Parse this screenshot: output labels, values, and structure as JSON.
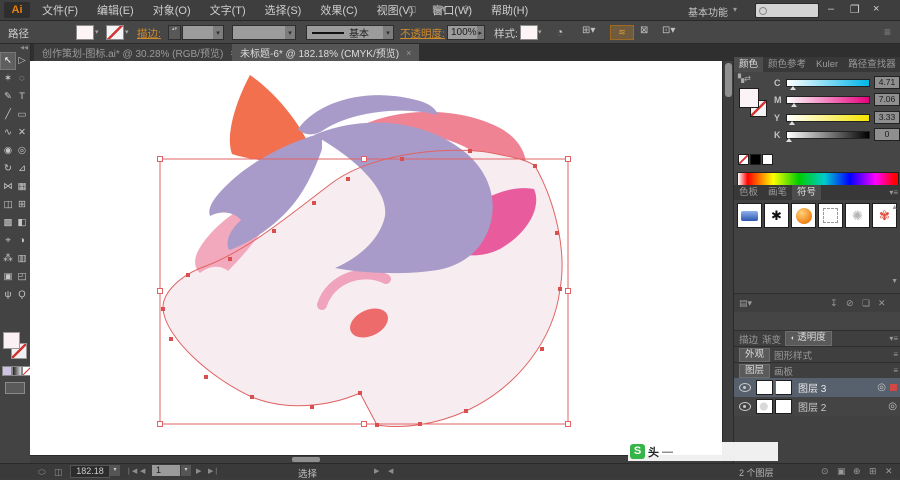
{
  "titlebar": {
    "logo": "Ai",
    "menus": [
      "文件(F)",
      "编辑(E)",
      "对象(O)",
      "文字(T)",
      "选择(S)",
      "效果(C)",
      "视图(V)",
      "窗口(W)",
      "帮助(H)"
    ],
    "workspace": "基本功能",
    "search_placeholder": "",
    "min": "–",
    "restore": "❐",
    "close": "×"
  },
  "options": {
    "target": "路径",
    "stroke_label": "描边:",
    "stroke_style": "基本",
    "opacity_label": "不透明度:",
    "opacity": "100%",
    "style_label": "样式:"
  },
  "doc_tabs": [
    {
      "title": "创作策划-图标.ai* @ 30.28% (RGB/预览)"
    },
    {
      "title": "未标题-6* @ 182.18% (CMYK/预览)"
    }
  ],
  "ui": {
    "close": "×",
    "caret": "▾",
    "menu": "≡",
    "collapse": "◀◀",
    "updown": "▴▾"
  },
  "tools": [
    [
      "↖",
      "▷"
    ],
    [
      "✶",
      "◌"
    ],
    [
      "✎",
      "T"
    ],
    [
      "╱",
      "▭"
    ],
    [
      "∿",
      "✕"
    ],
    [
      "◉",
      "◎"
    ],
    [
      "↻",
      "⊿"
    ],
    [
      "⋈",
      "▦"
    ],
    [
      "◫",
      "⊞"
    ],
    [
      "▩",
      "◧"
    ],
    [
      "⌖",
      "◑"
    ],
    [
      "⁂",
      "▥"
    ],
    [
      "▣",
      "◰"
    ],
    [
      "ψ",
      "Ϙ"
    ]
  ],
  "color_panel": {
    "tabs": [
      "颜色",
      "颜色参考",
      "Kuler",
      "路径查找器"
    ],
    "channels": [
      {
        "label": "C",
        "value": "4.71"
      },
      {
        "label": "M",
        "value": "7.06"
      },
      {
        "label": "Y",
        "value": "3.33"
      },
      {
        "label": "K",
        "value": "0"
      }
    ],
    "unit": "%"
  },
  "swatch_panel": {
    "tabs": [
      "色板",
      "画笔",
      "符号"
    ],
    "symbols": [
      "banner-blue",
      "splatter-black",
      "orb-orange",
      "frame-dashed",
      "ring-silver",
      "flower-red"
    ]
  },
  "groups": {
    "stroke": "描边",
    "gradient": "渐变",
    "transparency": "透明度",
    "appearance": "外观",
    "graphic_styles": "图形样式",
    "layers": "图层",
    "artboards": "画板"
  },
  "layers_panel": {
    "items": [
      {
        "name": "图层 3"
      },
      {
        "name": "图层 2"
      }
    ],
    "count": "2 个图层"
  },
  "status": {
    "zoom": "182.18",
    "artboard": "1",
    "mode": "选择"
  },
  "watermark": {
    "badge": "S",
    "text": "头",
    "dash": "—"
  },
  "artwork": {
    "subject": "unicorn-head-illustration",
    "palette": {
      "horn": "#f2704e",
      "mane_purple": "#a89bc9",
      "mane_salmon": "#ef8394",
      "mane_pink": "#f3a9bd",
      "head": "#f7edf1",
      "inner_ear": "#e85c9e",
      "eye": "#f0a3bd",
      "nostril": "#ed6b6b",
      "selection": "#e06363"
    }
  }
}
